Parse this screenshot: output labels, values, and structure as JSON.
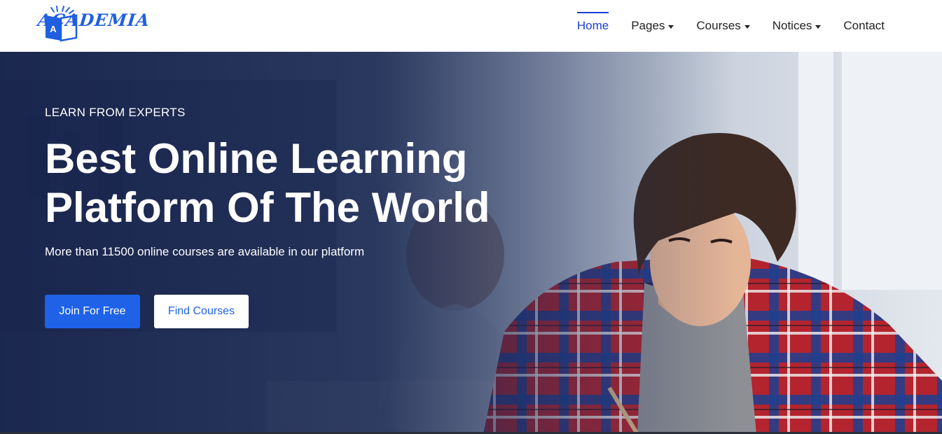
{
  "brand": {
    "name": "ACADEMIA",
    "badge_letter": "A"
  },
  "nav": {
    "items": [
      {
        "label": "Home",
        "active": true,
        "dropdown": false
      },
      {
        "label": "Pages",
        "active": false,
        "dropdown": true
      },
      {
        "label": "Courses",
        "active": false,
        "dropdown": true
      },
      {
        "label": "Notices",
        "active": false,
        "dropdown": true
      },
      {
        "label": "Contact",
        "active": false,
        "dropdown": false
      }
    ]
  },
  "hero": {
    "eyebrow": "LEARN FROM EXPERTS",
    "headline_line1": "Best Online Learning",
    "headline_line2": "Platform Of The World",
    "subtext": "More than 11500 online courses are available in our platform",
    "primary_button": "Join For Free",
    "secondary_button": "Find Courses"
  },
  "colors": {
    "accent": "#1f62e8",
    "nav_active": "#1a3fd6",
    "logo": "#1f5fe0",
    "hero_overlay": "#1e2b52"
  }
}
